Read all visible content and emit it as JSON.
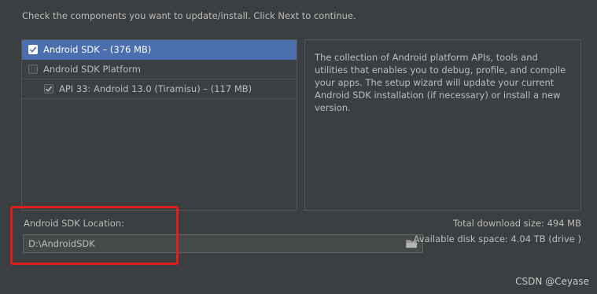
{
  "instructions": "Check the components you want to update/install. Click Next to continue.",
  "components": [
    {
      "label": "Android SDK – (376 MB)",
      "checked": true,
      "selected": true,
      "indent": 0
    },
    {
      "label": "Android SDK Platform",
      "checked": false,
      "selected": false,
      "indent": 0
    },
    {
      "label": "API 33: Android 13.0 (Tiramisu) – (117 MB)",
      "checked": true,
      "selected": false,
      "indent": 1
    }
  ],
  "description": "The collection of Android platform APIs, tools and utilities that enables you to debug, profile, and compile your apps. The setup wizard will update your current Android SDK installation (if necessary) or install a new version.",
  "sdk_location": {
    "label": "Android SDK Location:",
    "path": "D:\\AndroidSDK",
    "browse_icon": "folder-icon"
  },
  "summary": {
    "total_download": "Total download size: 494 MB",
    "available_disk": "Available disk space: 4.04 TB (drive )"
  },
  "watermark": "CSDN @Ceyase",
  "colors": {
    "background": "#3c3f41",
    "selection": "#4b6eaf",
    "highlight_box": "#e31c1c"
  }
}
